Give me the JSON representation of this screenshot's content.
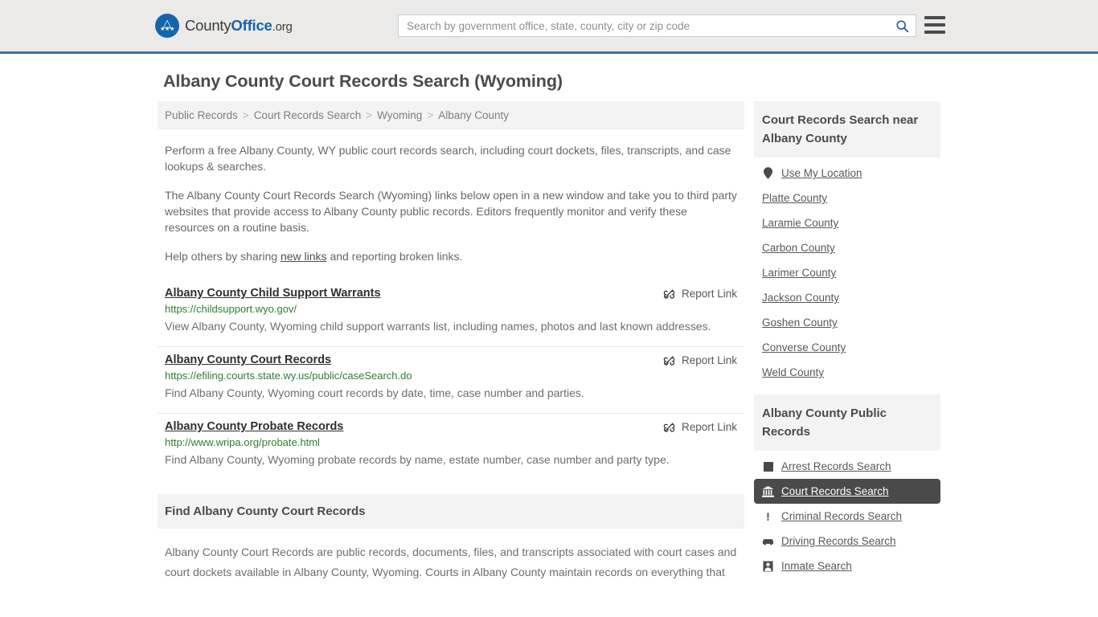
{
  "header": {
    "brand": {
      "part1": "County",
      "part2": "Office",
      "part3": ".org",
      "icon": "eagle-seal-icon"
    },
    "search": {
      "placeholder": "Search by government office, state, county, city or zip code",
      "value": "",
      "icon": "search-icon"
    },
    "menu_icon": "hamburger-menu-icon",
    "accent_color": "#3a72a8",
    "background_color": "#ebeae9"
  },
  "page": {
    "title": "Albany County Court Records Search (Wyoming)",
    "breadcrumb": [
      {
        "label": "Public Records"
      },
      {
        "label": "Court Records Search"
      },
      {
        "label": "Wyoming"
      },
      {
        "label": "Albany County"
      }
    ],
    "breadcrumb_separator": ">",
    "intro": [
      "Perform a free Albany County, WY public court records search, including court dockets, files, transcripts, and case lookups & searches.",
      "The Albany County Court Records Search (Wyoming) links below open in a new window and take you to third party websites that provide access to Albany County public records. Editors frequently monitor and verify these resources on a routine basis."
    ],
    "help_prefix": "Help others by sharing ",
    "help_link": "new links",
    "help_suffix": " and reporting broken links.",
    "report_link_label": "Report Link",
    "report_link_icon": "broken-link-icon",
    "results": [
      {
        "title": "Albany County Child Support Warrants",
        "url": "https://childsupport.wyo.gov/",
        "description": "View Albany County, Wyoming child support warrants list, including names, photos and last known addresses."
      },
      {
        "title": "Albany County Court Records",
        "url": "https://efiling.courts.state.wy.us/public/caseSearch.do",
        "description": "Find Albany County, Wyoming court records by date, time, case number and parties."
      },
      {
        "title": "Albany County Probate Records",
        "url": "http://www.wripa.org/probate.html",
        "description": "Find Albany County, Wyoming probate records by name, estate number, case number and party type."
      }
    ],
    "section": {
      "heading": "Find Albany County Court Records",
      "body": "Albany County Court Records are public records, documents, files, and transcripts associated with court cases and court dockets available in Albany County, Wyoming. Courts in Albany County maintain records on everything that"
    }
  },
  "sidebar": {
    "nearby": {
      "heading": "Court Records Search near Albany County",
      "items": [
        {
          "label": "Use My Location",
          "icon": "map-pin-icon"
        },
        {
          "label": "Platte County",
          "icon": null
        },
        {
          "label": "Laramie County",
          "icon": null
        },
        {
          "label": "Carbon County",
          "icon": null
        },
        {
          "label": "Larimer County",
          "icon": null
        },
        {
          "label": "Jackson County",
          "icon": null
        },
        {
          "label": "Goshen County",
          "icon": null
        },
        {
          "label": "Converse County",
          "icon": null
        },
        {
          "label": "Weld County",
          "icon": null
        }
      ]
    },
    "public_records": {
      "heading": "Albany County Public Records",
      "active_color": "#4a4a4a",
      "items": [
        {
          "label": "Arrest Records Search",
          "icon": "square-icon",
          "active": false
        },
        {
          "label": "Court Records Search",
          "icon": "courthouse-icon",
          "active": true
        },
        {
          "label": "Criminal Records Search",
          "icon": "exclamation-icon",
          "active": false
        },
        {
          "label": "Driving Records Search",
          "icon": "car-icon",
          "active": false
        },
        {
          "label": "Inmate Search",
          "icon": "inmate-icon",
          "active": false
        }
      ]
    }
  }
}
